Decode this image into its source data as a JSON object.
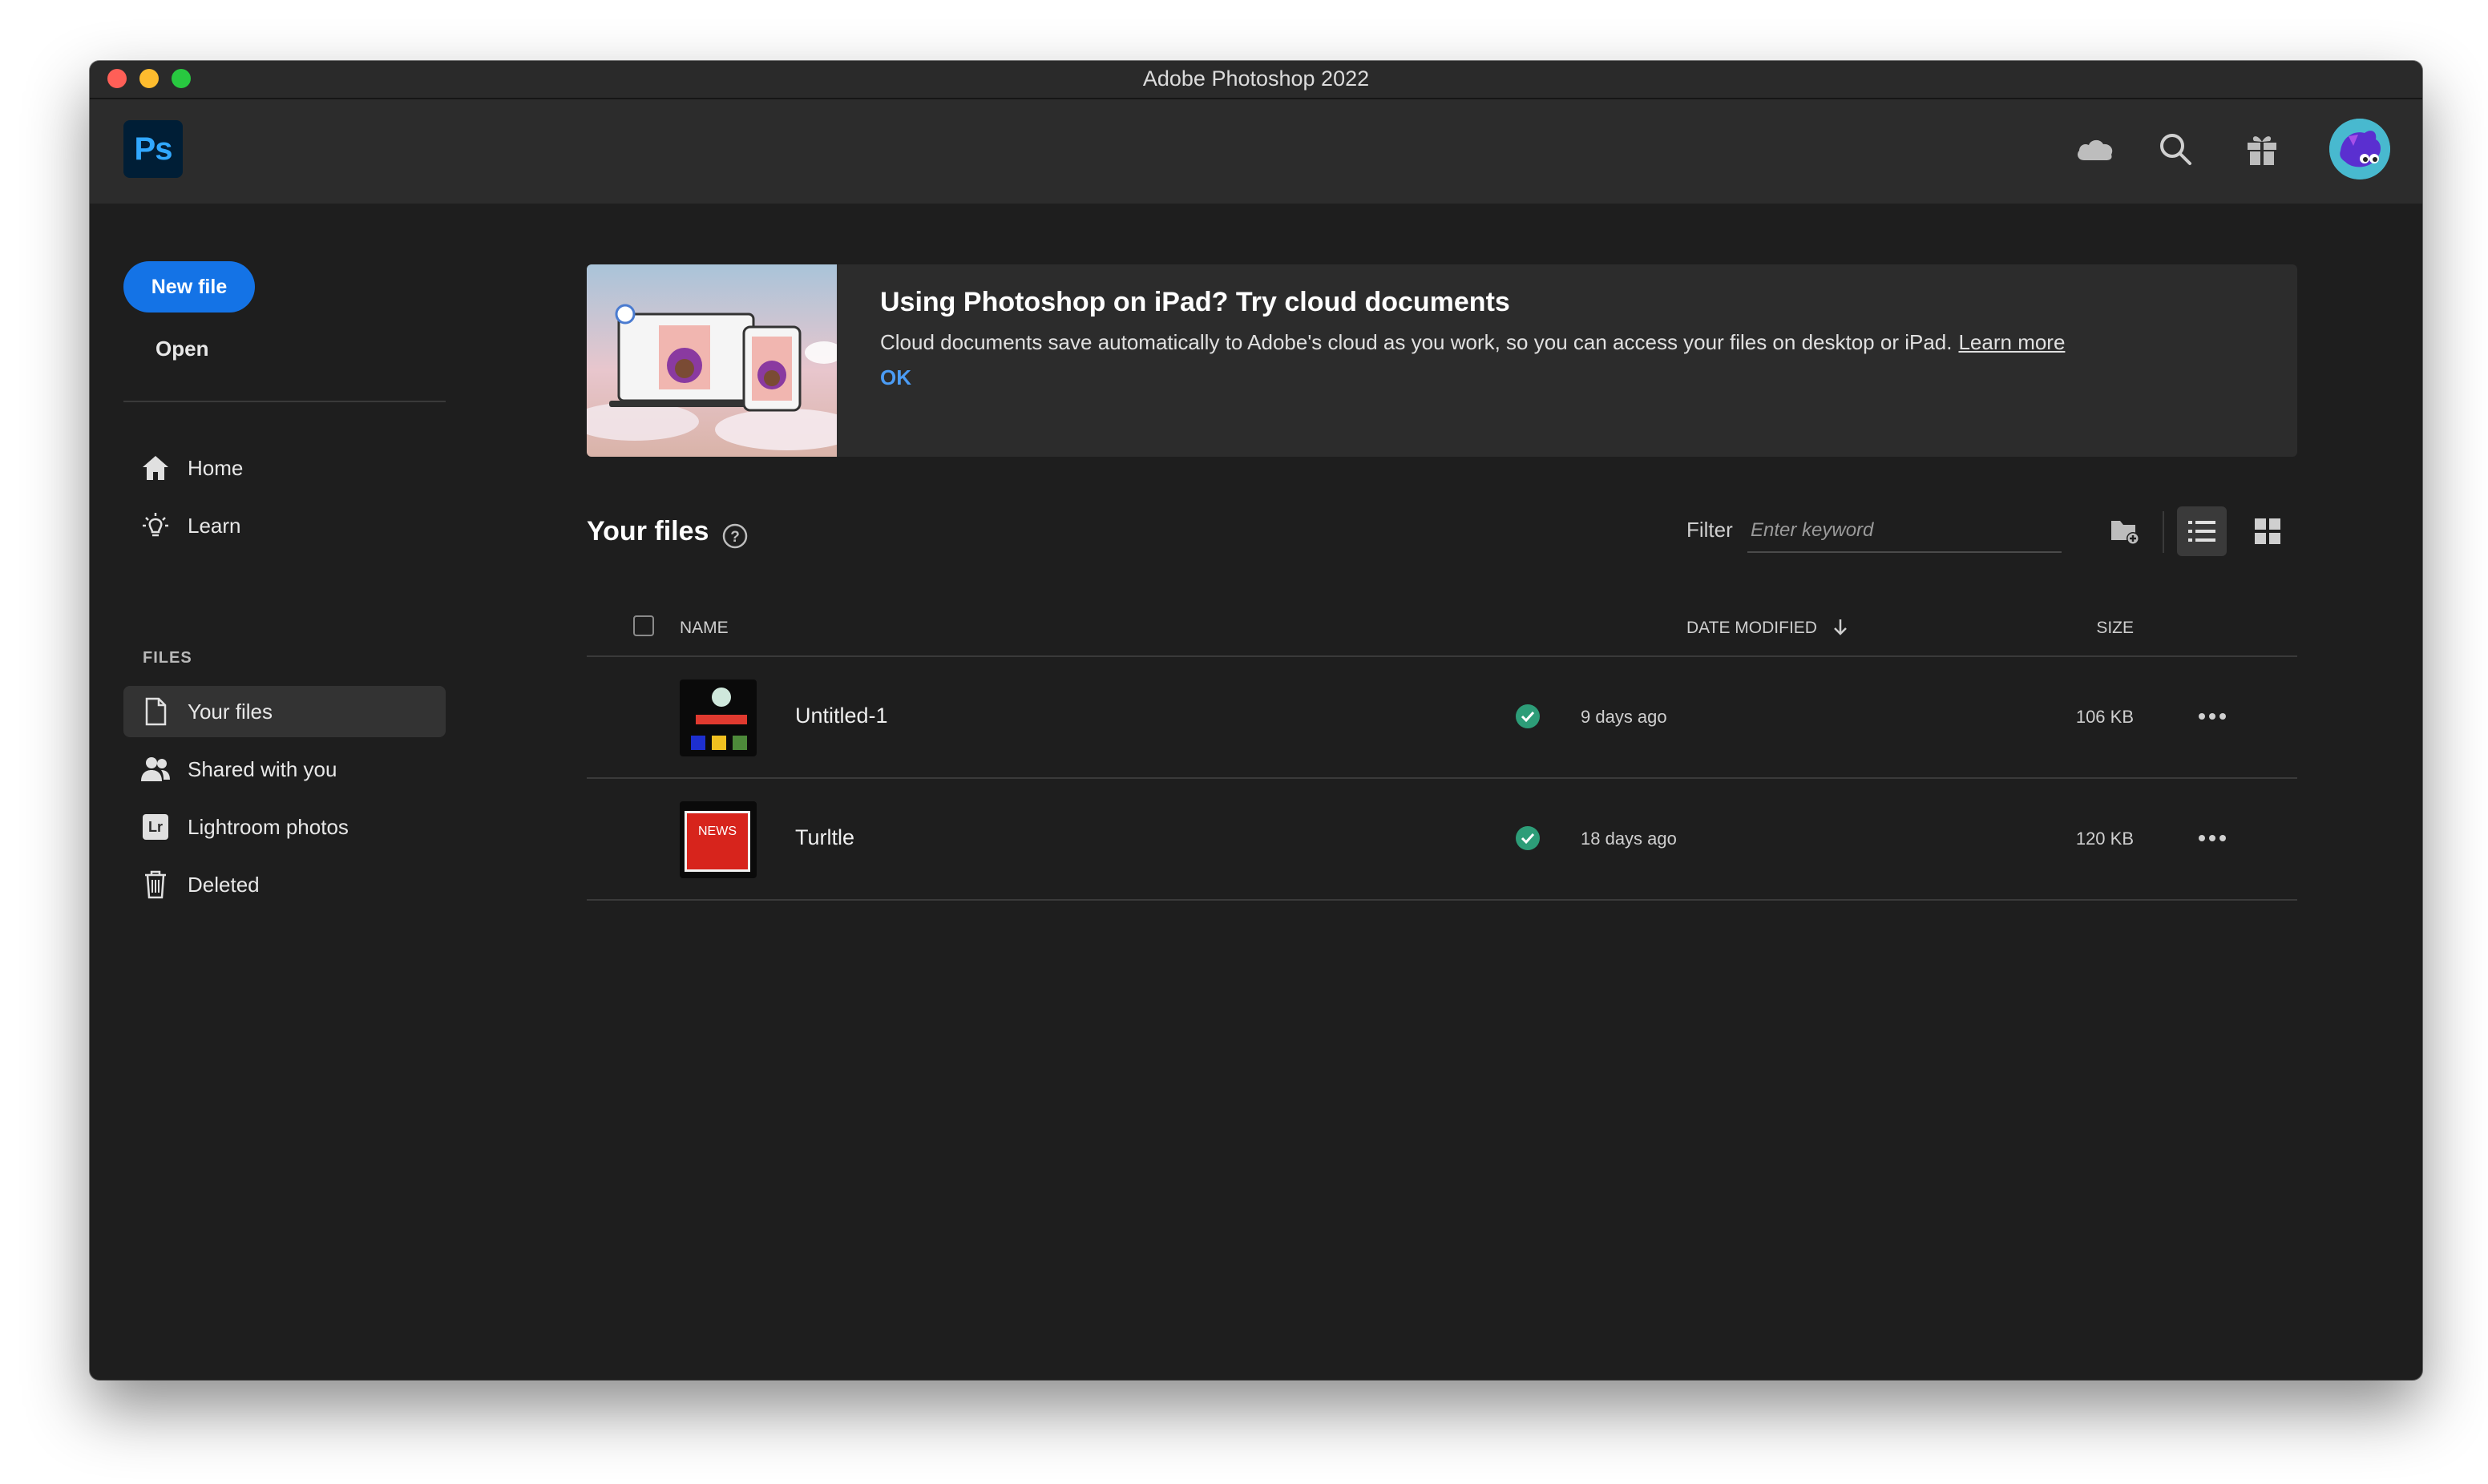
{
  "window": {
    "title": "Adobe Photoshop 2022"
  },
  "header": {
    "logo_text": "Ps",
    "icons": [
      "cloud-icon",
      "search-icon",
      "gift-icon",
      "avatar"
    ]
  },
  "sidebar": {
    "new_file_label": "New file",
    "open_label": "Open",
    "nav": [
      {
        "label": "Home",
        "icon": "home-icon"
      },
      {
        "label": "Learn",
        "icon": "lightbulb-icon"
      }
    ],
    "files_section_label": "FILES",
    "files_nav": [
      {
        "label": "Your files",
        "icon": "file-icon",
        "active": true
      },
      {
        "label": "Shared with you",
        "icon": "people-icon"
      },
      {
        "label": "Lightroom photos",
        "icon": "lightroom-icon",
        "icon_text": "Lr"
      },
      {
        "label": "Deleted",
        "icon": "trash-icon"
      }
    ]
  },
  "banner": {
    "title": "Using Photoshop on iPad? Try cloud documents",
    "body": "Cloud documents save automatically to Adobe's cloud as you work, so you can access your files on desktop or iPad.",
    "learn_more": "Learn more",
    "ok_label": "OK"
  },
  "files": {
    "title": "Your files",
    "filter_label": "Filter",
    "filter_placeholder": "Enter keyword",
    "columns": {
      "name": "NAME",
      "date_modified": "DATE MODIFIED",
      "size": "SIZE"
    },
    "rows": [
      {
        "name": "Untitled-1",
        "date": "9 days ago",
        "size": "106 KB",
        "synced": true
      },
      {
        "name": "Turltle",
        "date": "18 days ago",
        "size": "120 KB",
        "synced": true,
        "thumb_text": "NEWS"
      }
    ]
  },
  "colors": {
    "accent": "#1473e6",
    "link": "#4b9cf5",
    "sync_ok": "#2d9d78",
    "background": "#1e1e1e",
    "panel": "#2c2c2c"
  }
}
